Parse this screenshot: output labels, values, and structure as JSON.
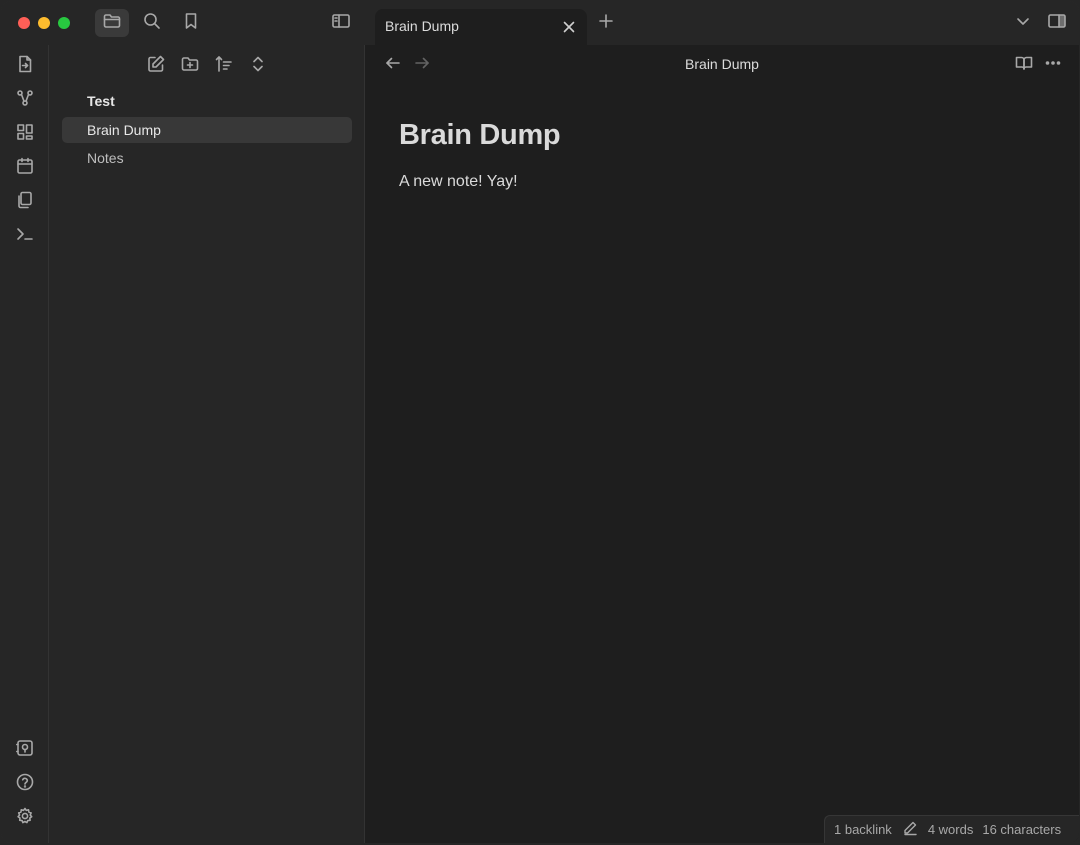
{
  "tab": {
    "title": "Brain Dump"
  },
  "explorer": {
    "folder": "Test",
    "files": [
      {
        "label": "Brain Dump",
        "active": true
      },
      {
        "label": "Notes",
        "active": false
      }
    ]
  },
  "editor": {
    "view_title": "Brain Dump",
    "heading": "Brain Dump",
    "body": "A new note! Yay!"
  },
  "status": {
    "backlinks": "1 backlink",
    "words": "4 words",
    "characters": "16 characters"
  },
  "icons": {
    "titlebar": [
      "folder-icon",
      "search-icon",
      "bookmark-icon",
      "sidebar-toggle-icon",
      "new-tab-icon",
      "tab-list-icon",
      "right-sidebar-toggle-icon"
    ],
    "ribbon": [
      "file-switch-icon",
      "graph-icon",
      "canvas-icon",
      "calendar-icon",
      "templates-icon",
      "terminal-icon",
      "vault-icon",
      "help-icon",
      "settings-icon"
    ],
    "explorer": [
      "new-note-icon",
      "new-folder-icon",
      "sort-icon",
      "collapse-icon"
    ],
    "editor": [
      "back-icon",
      "forward-icon",
      "reading-view-icon",
      "more-options-icon",
      "edit-pencil-icon"
    ]
  },
  "colors": {
    "background": "#1e1e1e",
    "panel": "#262626",
    "active_item": "#383838",
    "text": "#dadada",
    "muted": "#a8a8a8"
  }
}
